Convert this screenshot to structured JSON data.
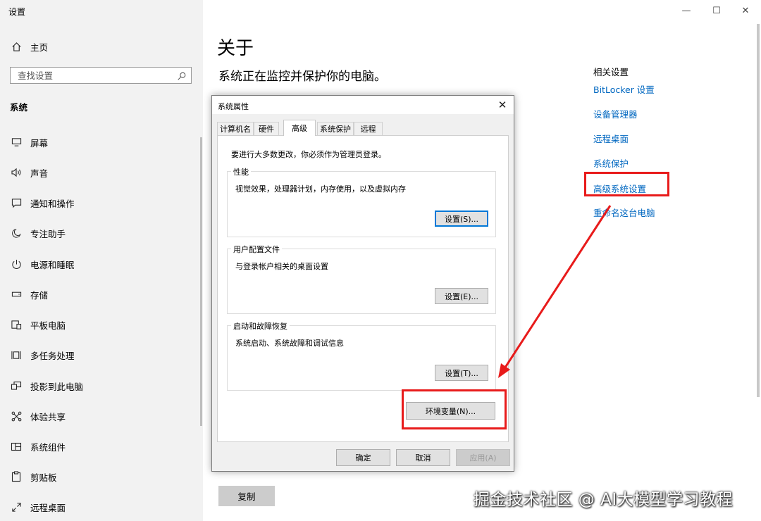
{
  "app_title": "设置",
  "sidebar": {
    "home_label": "主页",
    "search_placeholder": "查找设置",
    "section_title": "系统",
    "items": [
      {
        "label": "屏幕",
        "icon": "monitor-icon"
      },
      {
        "label": "声音",
        "icon": "speaker-icon"
      },
      {
        "label": "通知和操作",
        "icon": "notification-icon"
      },
      {
        "label": "专注助手",
        "icon": "moon-icon"
      },
      {
        "label": "电源和睡眠",
        "icon": "power-icon"
      },
      {
        "label": "存储",
        "icon": "storage-icon"
      },
      {
        "label": "平板电脑",
        "icon": "tablet-icon"
      },
      {
        "label": "多任务处理",
        "icon": "multitask-icon"
      },
      {
        "label": "投影到此电脑",
        "icon": "project-icon"
      },
      {
        "label": "体验共享",
        "icon": "share-icon"
      },
      {
        "label": "系统组件",
        "icon": "components-icon"
      },
      {
        "label": "剪贴板",
        "icon": "clipboard-icon"
      },
      {
        "label": "远程桌面",
        "icon": "remote-icon"
      }
    ]
  },
  "window_controls": {
    "minimize": "—",
    "maximize": "☐",
    "close": "✕"
  },
  "main": {
    "title": "关于",
    "subtitle": "系统正在监控并保护你的电脑。",
    "copy_button": "复制"
  },
  "related": {
    "title": "相关设置",
    "links": [
      "BitLocker 设置",
      "设备管理器",
      "远程桌面",
      "系统保护",
      "高级系统设置",
      "重命名这台电脑"
    ]
  },
  "dialog": {
    "title": "系统属性",
    "tabs": [
      "计算机名",
      "硬件",
      "高级",
      "系统保护",
      "远程"
    ],
    "active_tab": "高级",
    "admin_note": "要进行大多数更改，你必须作为管理员登录。",
    "groups": [
      {
        "title": "性能",
        "desc": "视觉效果，处理器计划，内存使用，以及虚拟内存",
        "button": "设置(S)..."
      },
      {
        "title": "用户配置文件",
        "desc": "与登录帐户相关的桌面设置",
        "button": "设置(E)..."
      },
      {
        "title": "启动和故障恢复",
        "desc": "系统启动、系统故障和调试信息",
        "button": "设置(T)..."
      }
    ],
    "env_button": "环境变量(N)...",
    "ok": "确定",
    "cancel": "取消",
    "apply": "应用(A)"
  },
  "watermark": "掘金技术社区 @ AI大模型学习教程",
  "colors": {
    "link": "#0067c0",
    "annotation": "#e81b1b",
    "sidebar_bg": "#f2f2f2",
    "dialog_bg": "#f0f0f0"
  }
}
